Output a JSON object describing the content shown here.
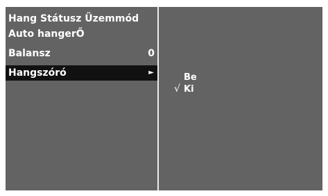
{
  "menu": {
    "items": [
      {
        "label": "Hang Státusz Üzemmód",
        "value": ""
      },
      {
        "label": "Auto hangerŐ",
        "value": ""
      },
      {
        "label": "Balansz",
        "value": "0"
      },
      {
        "label": "Hangszóró",
        "value": "",
        "arrow": "►"
      }
    ],
    "selected_index": 3
  },
  "submenu": {
    "options": [
      {
        "label": "Be",
        "checked": false
      },
      {
        "label": "Ki",
        "checked": true
      }
    ],
    "check_mark": "√"
  },
  "colors": {
    "panel_bg": "#636363",
    "selected_bg": "#111111",
    "divider": "#ededed",
    "text": "#ffffff"
  },
  "icons": {
    "arrow": "arrow-right-icon",
    "check": "check-mark-icon"
  }
}
